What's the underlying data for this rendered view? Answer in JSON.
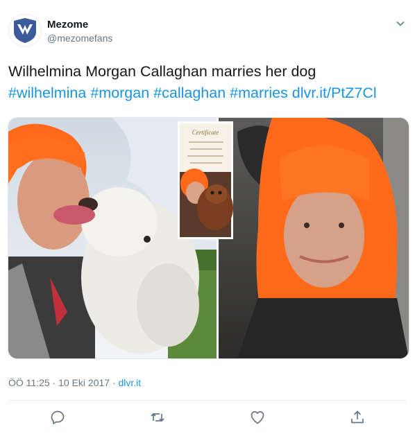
{
  "account": {
    "name": "Mezome",
    "handle": "@mezomefans",
    "avatar_icon": "mezome-wing-logo-icon"
  },
  "tweet": {
    "text_plain": "Wilhelmina Morgan Callaghan marries her dog",
    "hashtags": [
      "#wilhelmina",
      "#morgan",
      "#callaghan",
      "#marries"
    ],
    "link": "dlvr.it/PtZ7Cl"
  },
  "media": {
    "alt_text": "Collage photos of a woman with bright orange hair with her dog and a certificate",
    "certificate_heading": "Certificate"
  },
  "meta": {
    "timestamp": "ÖÖ 11:25 · 10 Eki 2017 · ",
    "source": "dlvr.it"
  },
  "actions": [
    {
      "name": "reply",
      "icon": "reply-icon"
    },
    {
      "name": "retweet",
      "icon": "retweet-icon"
    },
    {
      "name": "like",
      "icon": "heart-icon"
    },
    {
      "name": "share",
      "icon": "share-icon"
    }
  ],
  "colors": {
    "link": "#1b95e0",
    "text": "#14171a",
    "muted": "#657786",
    "hair": "#ff6a1a",
    "logo": "#3b5b9a"
  }
}
